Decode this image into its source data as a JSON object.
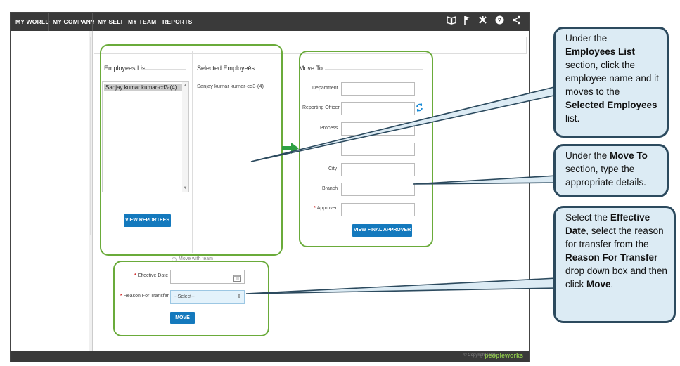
{
  "nav": {
    "items": [
      "MY WORLD",
      "MY COMPANY",
      "MY SELF",
      "MY TEAM",
      "REPORTS"
    ],
    "icons": [
      "book-icon",
      "pin-icon",
      "tools-icon",
      "help-icon",
      "share-icon"
    ]
  },
  "employees": {
    "title": "Employees List",
    "items": [
      "Sanjay kumar kumar-cd3-(4)"
    ],
    "button": "VIEW REPORTEES"
  },
  "selected": {
    "title": "Selected Employees",
    "count": "1",
    "items": [
      "Sanjay kumar kumar-cd3-(4)"
    ]
  },
  "move_to": {
    "title": "Move To",
    "department": "Department",
    "reporting_officer": "Reporting Officer",
    "process": "Process",
    "city": "City",
    "branch": "Branch",
    "approver": "Approver",
    "button": "VIEW FINAL APPROVER"
  },
  "move_with_team": "Move with team",
  "bottom": {
    "effective_date": "Effective Date",
    "reason": "Reason For Transfer",
    "reason_value": "--Select--",
    "move_button": "MOVE"
  },
  "footer": {
    "copyright": "© Copyright 2018",
    "brand": "peopleworks"
  },
  "callouts": {
    "one": {
      "t1": "Under the",
      "b1": "Employees List",
      "t2": "section, click the employee name and it moves to the",
      "b2": "Selected Employees",
      "t3": "list."
    },
    "two": {
      "t1": "Under the",
      "b1": "Move To",
      "t2": "section, type the appropriate details."
    },
    "three": {
      "t1": "Select the",
      "b1": "Effective Date",
      "t2": ", select the reason for transfer from the",
      "b2": "Reason For Transfer",
      "t3": "drop down box and then click",
      "b3": "Move",
      "t4": "."
    }
  },
  "colors": {
    "nav_bg": "#3a3a3a",
    "button_blue": "#1479bd",
    "highlight_green": "#6aab3a",
    "callout_fill": "#dcebf4",
    "callout_border": "#2c4a5e",
    "required_red": "#d32f2f"
  }
}
